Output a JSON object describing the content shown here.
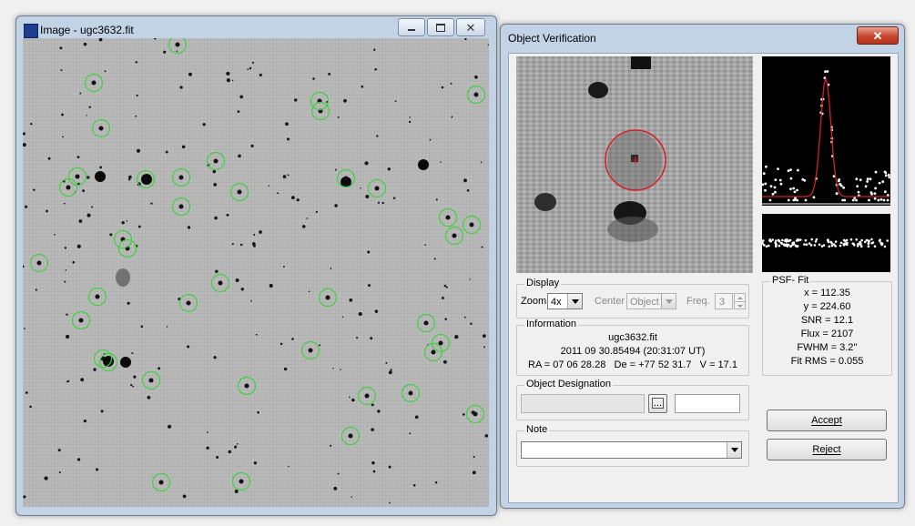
{
  "image_window": {
    "title": "Image - ugc3632.fit",
    "minimize_icon": "minimize-icon",
    "maximize_icon": "maximize-icon",
    "close_icon": "close-icon",
    "colors": {
      "ring": "#3fd13f"
    }
  },
  "dialog": {
    "title": "Object Verification",
    "close_icon": "close-icon",
    "display": {
      "group_label": "Display",
      "zoom_label": "Zoom",
      "zoom_value": "4x",
      "center_label": "Center",
      "center_value": "Object",
      "freq_label": "Freq.",
      "freq_value": "3"
    },
    "information": {
      "group_label": "Information",
      "file": "ugc3632.fit",
      "date": "2011 09 30.85494 (20:31:07 UT)",
      "coords": "RA = 07 06 28.28   De = +77 52 31.7   V = 17.1"
    },
    "designation": {
      "group_label": "Object Designation",
      "browse_label": "..."
    },
    "note": {
      "group_label": "Note"
    },
    "psf_fit": {
      "group_label": "PSF- Fit",
      "x": "x = 112.35",
      "y": "y = 224.60",
      "snr": "SNR = 12.1",
      "flux": "Flux = 2107",
      "fwhm": "FWHM = 3.2''",
      "fit_rms": "Fit RMS = 0.055"
    },
    "buttons": {
      "accept": "Accept",
      "reject": "Reject"
    },
    "colors": {
      "aperture": "#d42020",
      "profile": "#d42020"
    }
  }
}
